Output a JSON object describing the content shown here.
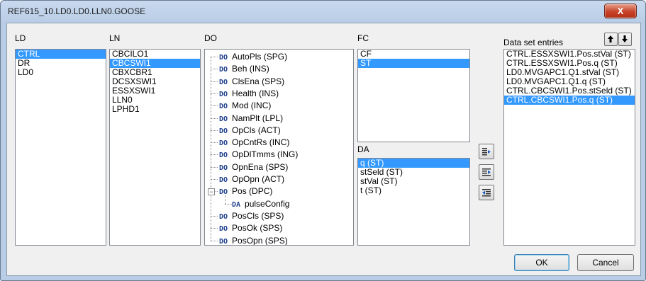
{
  "window": {
    "title": "REF615_10.LD0.LD0.LLN0.GOOSE",
    "close_label": "X"
  },
  "ld": {
    "header": "LD",
    "items": [
      "CTRL",
      "DR",
      "LD0"
    ],
    "selected": 0
  },
  "ln": {
    "header": "LN",
    "items": [
      "CBCILO1",
      "CBCSWI1",
      "CBXCBR1",
      "DCSXSWI1",
      "ESSXSWI1",
      "LLN0",
      "LPHD1"
    ],
    "selected": 1
  },
  "do": {
    "header": "DO",
    "items": [
      {
        "tag": "DO",
        "label": "AutoPls (SPG)"
      },
      {
        "tag": "DO",
        "label": "Beh (INS)"
      },
      {
        "tag": "DO",
        "label": "ClsEna (SPS)"
      },
      {
        "tag": "DO",
        "label": "Health (INS)"
      },
      {
        "tag": "DO",
        "label": "Mod (INC)"
      },
      {
        "tag": "DO",
        "label": "NamPlt (LPL)"
      },
      {
        "tag": "DO",
        "label": "OpCls (ACT)"
      },
      {
        "tag": "DO",
        "label": "OpCntRs (INC)"
      },
      {
        "tag": "DO",
        "label": "OpDlTmms (ING)"
      },
      {
        "tag": "DO",
        "label": "OpnEna (SPS)"
      },
      {
        "tag": "DO",
        "label": "OpOpn (ACT)"
      },
      {
        "tag": "DO",
        "label": "Pos (DPC)",
        "expanded": true
      },
      {
        "tag": "DA",
        "label": "pulseConfig",
        "child": true
      },
      {
        "tag": "DO",
        "label": "PosCls (SPS)"
      },
      {
        "tag": "DO",
        "label": "PosOk (SPS)"
      },
      {
        "tag": "DO",
        "label": "PosOpn (SPS)"
      }
    ],
    "expander_symbol": "−"
  },
  "fc": {
    "header": "FC",
    "items": [
      "CF",
      "ST"
    ],
    "selected": 1
  },
  "da": {
    "header": "DA",
    "items": [
      "q (ST)",
      "stSeld (ST)",
      "stVal (ST)",
      "t (ST)"
    ],
    "selected": 0
  },
  "entries": {
    "header": "Data set entries",
    "items": [
      "CTRL.ESSXSWI1.Pos.stVal (ST)",
      "CTRL.ESSXSWI1.Pos.q (ST)",
      "LD0.MVGAPC1.Q1.stVal (ST)",
      "LD0.MVGAPC1.Q1.q (ST)",
      "CTRL.CBCSWI1.Pos.stSeld (ST)",
      "CTRL.CBCSWI1.Pos.q (ST)"
    ],
    "selected": 5
  },
  "buttons": {
    "ok": "OK",
    "cancel": "Cancel"
  },
  "colors": {
    "selection": "#3399ff",
    "tree_tag": "#1f3f8f"
  }
}
